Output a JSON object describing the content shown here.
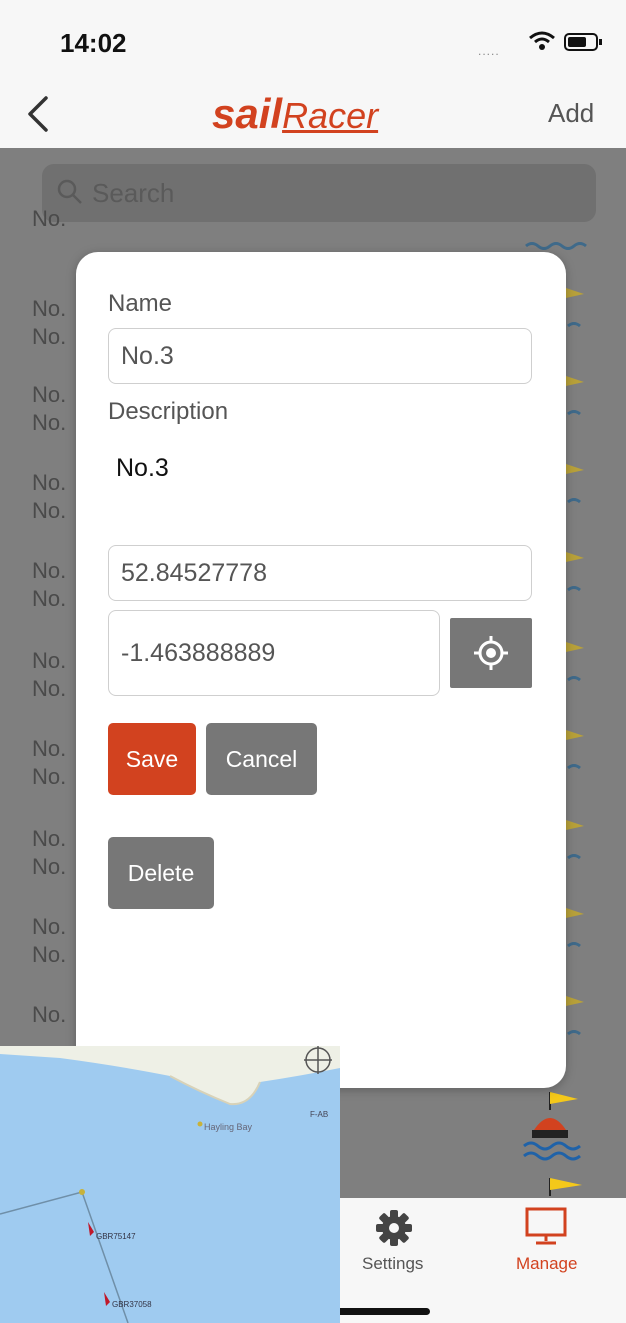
{
  "status": {
    "time": "14:02",
    "signal_dots": "....."
  },
  "nav": {
    "back_icon": "chevron-left-icon",
    "logo_sail": "sail",
    "logo_racer": "Racer",
    "add_label": "Add"
  },
  "search": {
    "placeholder": "Search"
  },
  "list": {
    "rows": [
      {
        "line1": "No.",
        "line2": "No."
      },
      {
        "line1": "No.",
        "line2": "No."
      },
      {
        "line1": "No.",
        "line2": "No."
      },
      {
        "line1": "No.",
        "line2": "No."
      },
      {
        "line1": "No.",
        "line2": "No."
      },
      {
        "line1": "No.",
        "line2": "No."
      },
      {
        "line1": "No.",
        "line2": "No."
      },
      {
        "line1": "No.",
        "line2": "No."
      },
      {
        "line1": "No.",
        "line2": "No."
      }
    ],
    "partial_row": "No."
  },
  "modal": {
    "name_label": "Name",
    "name_value": "No.3",
    "description_label": "Description",
    "description_value": "No.3",
    "latitude": "52.84527778",
    "longitude": "-1.463888889",
    "save_label": "Save",
    "cancel_label": "Cancel",
    "delete_label": "Delete"
  },
  "tabs": [
    {
      "label": "Settings",
      "icon": "gear-icon",
      "active": false
    },
    {
      "label": "Manage",
      "icon": "monitor-icon",
      "active": true
    }
  ],
  "map": {
    "place_label": "Hayling Bay",
    "boat1": "GBR75147",
    "boat2": "GBR37058",
    "compass_label": "F-AB"
  },
  "colors": {
    "accent": "#d2421f",
    "gray_button": "#777777",
    "water": "#9fcbf0"
  }
}
